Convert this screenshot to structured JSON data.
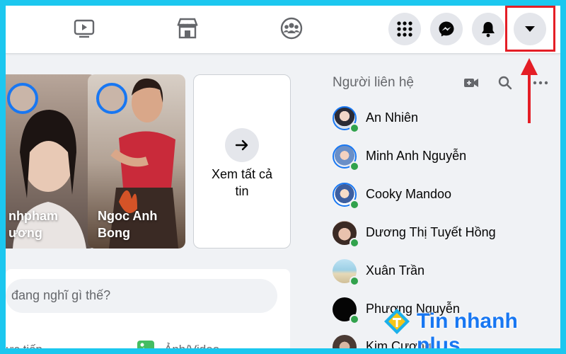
{
  "nav": {
    "icons": [
      "video-icon",
      "marketplace-icon",
      "groups-icon"
    ],
    "right_buttons": [
      "apps-grid-icon",
      "messenger-icon",
      "notifications-icon",
      "account-dropdown-icon"
    ]
  },
  "stories": [
    {
      "name": "nhpham\nương"
    },
    {
      "name": "Ngoc Anh\nBong"
    }
  ],
  "see_all": {
    "label": "Xem tất cả\ntin"
  },
  "composer": {
    "placeholder": "đang nghĩ gì thế?",
    "actions": [
      "ực tiếp",
      "Ảnh/Video"
    ]
  },
  "contacts": {
    "title": "Người liên hệ",
    "icons": [
      "new-room-icon",
      "search-icon",
      "more-icon"
    ],
    "items": [
      {
        "name": "An Nhiên",
        "online": true
      },
      {
        "name": "Minh Anh Nguyễn",
        "online": true
      },
      {
        "name": "Cooky Mandoo",
        "online": true
      },
      {
        "name": "Dương Thị Tuyết Hồng",
        "online": true
      },
      {
        "name": "Xuân Trần",
        "online": true
      },
      {
        "name": "Phương Nguyễn",
        "online": true
      },
      {
        "name": "Kim Cương",
        "online": false
      }
    ]
  },
  "watermark": {
    "text": "Tin nhanh plus"
  },
  "colors": {
    "annotation": "#e41e26",
    "brand": "#1877f2",
    "frame": "#1cc7ef"
  }
}
